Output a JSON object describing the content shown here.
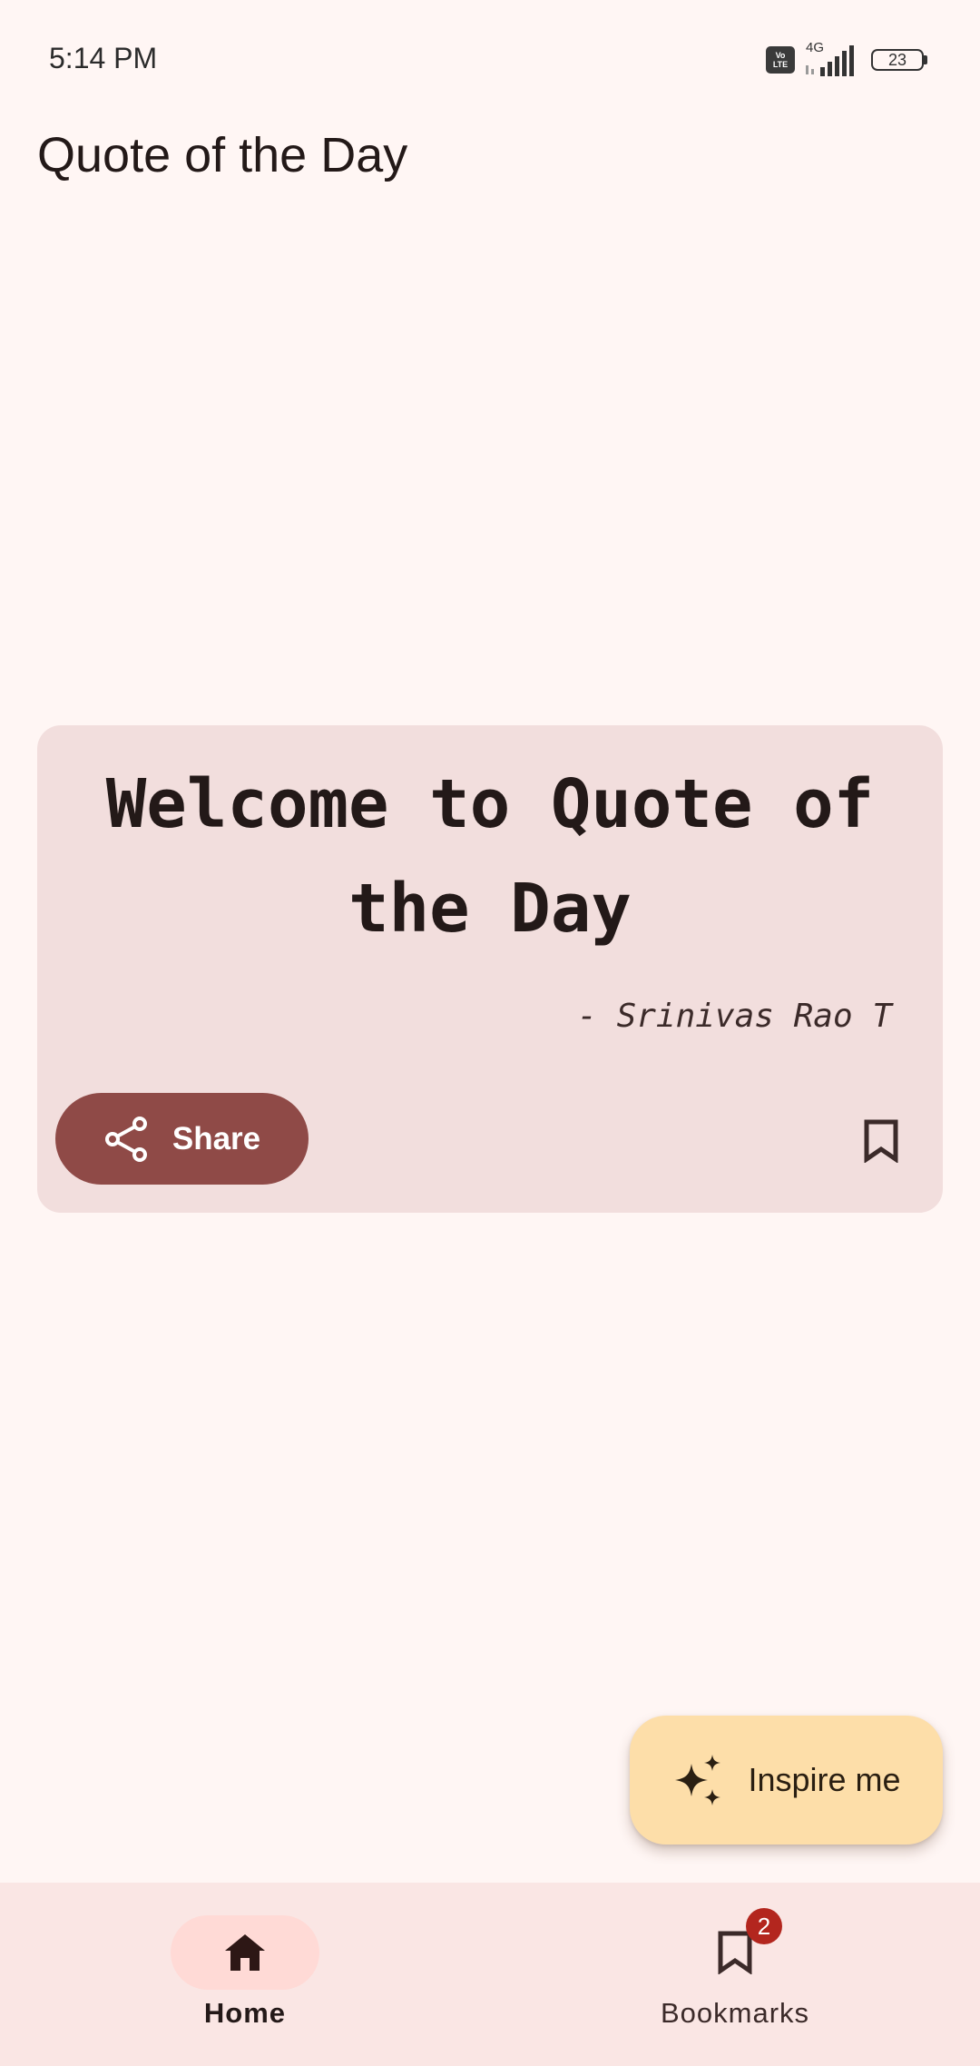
{
  "status_bar": {
    "time": "5:14 PM",
    "volte_top": "Vo",
    "volte_bottom": "LTE",
    "network_type": "4G",
    "battery_level": "23"
  },
  "header": {
    "title": "Quote of the Day"
  },
  "quote_card": {
    "quote": "Welcome to Quote of the Day",
    "author": "- Srinivas Rao T",
    "share_label": "Share",
    "share_icon": "share-icon",
    "bookmark_icon": "bookmark-outline-icon"
  },
  "fab": {
    "label": "Inspire me",
    "icon": "sparkle-icon"
  },
  "bottom_nav": {
    "items": [
      {
        "label": "Home",
        "icon": "home-icon",
        "selected": true
      },
      {
        "label": "Bookmarks",
        "icon": "bookmark-icon",
        "badge": "2",
        "selected": false
      }
    ]
  },
  "colors": {
    "background": "#FFF6F4",
    "card": "#F2DEDD",
    "share_button": "#8F4A47",
    "fab": "#FDDEA9",
    "nav_bar": "#FAE6E4",
    "nav_selected_indicator": "#FFDAD6",
    "badge": "#B3261E"
  }
}
